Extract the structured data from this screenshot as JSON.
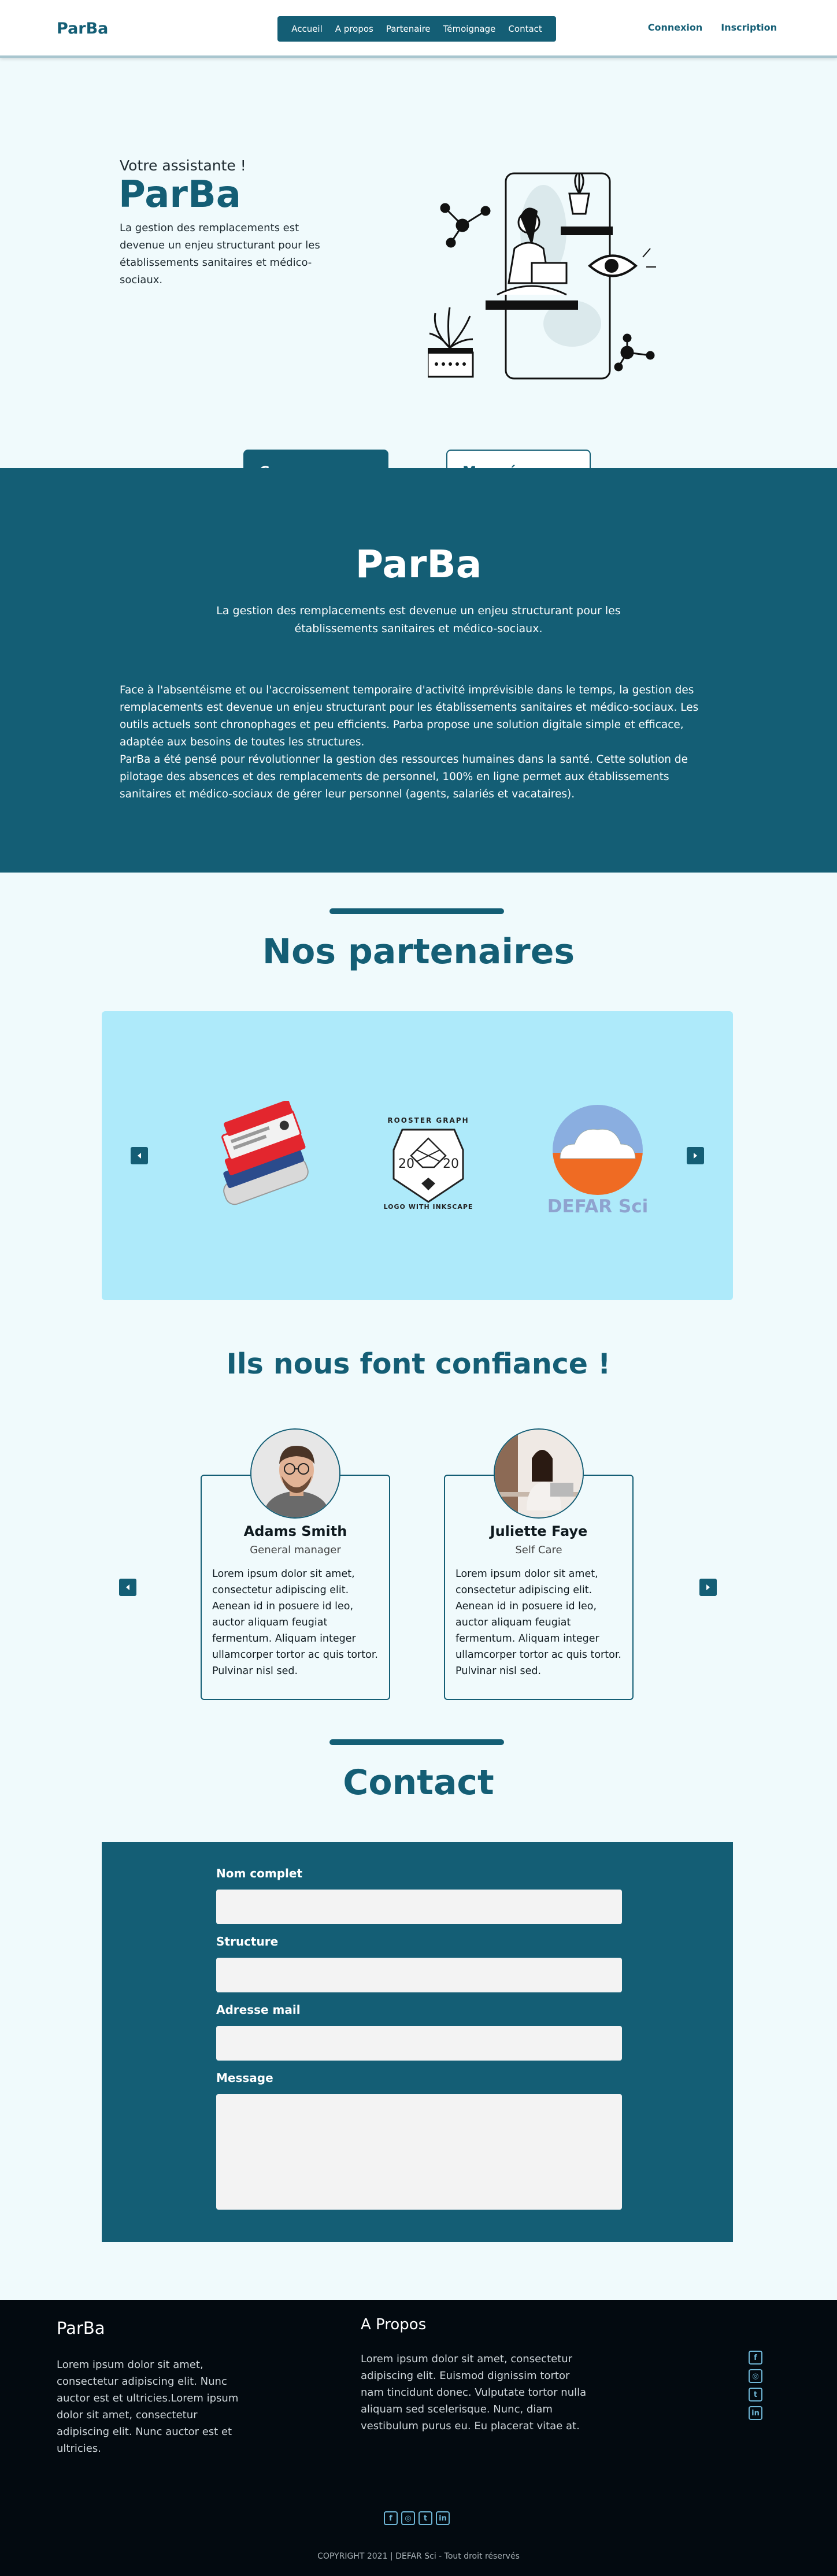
{
  "nav": {
    "logo": "ParBa",
    "menu": [
      "Accueil",
      "A propos",
      "Partenaire",
      "Témoignage",
      "Contact"
    ],
    "login": "Connexion",
    "signup": "Inscription"
  },
  "hero": {
    "kicker": "Votre assistante !",
    "title": "ParBa",
    "description": "La gestion des remplacements est devenue un enjeu structurant pour les établissements sanitaires et médico-sociaux.",
    "btn_primary": "Commencer",
    "btn_secondary": "Mon réseau"
  },
  "about": {
    "title": "ParBa",
    "subtitle": "La gestion des remplacements est devenue un enjeu structurant pour les établissements sanitaires et médico-sociaux.",
    "paragraph1": "Face à l'absentéisme et ou l'accroissement temporaire d'activité imprévisible dans le temps, la gestion des remplacements est devenue un enjeu structurant pour les établissements sanitaires et médico-sociaux. Les outils actuels sont chronophages et peu efficients. Parba propose une solution digitale simple et efficace, adaptée aux besoins de toutes les structures.",
    "paragraph2": "ParBa a été pensé pour révolutionner la gestion des ressources humaines dans la santé. Cette solution de pilotage des absences et des remplacements de personnel, 100% en ligne permet aux établissements sanitaires et médico-sociaux de gérer leur personnel (agents, salariés et vacataires)."
  },
  "partners": {
    "title": "Nos partenaires",
    "logo2_top": "ROOSTER GRAPH",
    "logo2_left": "20",
    "logo2_right": "20",
    "logo2_bottom": "LOGO WITH INKSCAPE",
    "logo3_text": "DEFAR Sci"
  },
  "testimonials": {
    "title": "Ils nous font confiance !",
    "items": [
      {
        "name": "Adams Smith",
        "role": "General manager",
        "text": "Lorem ipsum dolor sit amet, consectetur adipiscing elit. Aenean id in posuere id leo, auctor aliquam feugiat fermentum. Aliquam integer ullamcorper tortor ac quis tortor. Pulvinar nisl sed."
      },
      {
        "name": "Juliette Faye",
        "role": "Self Care",
        "text": "Lorem ipsum dolor sit amet, consectetur adipiscing elit. Aenean id in posuere id leo, auctor aliquam feugiat fermentum. Aliquam integer ullamcorper tortor ac quis tortor. Pulvinar nisl sed."
      }
    ]
  },
  "contact": {
    "title": "Contact",
    "fields": {
      "name": "Nom complet",
      "structure": "Structure",
      "email": "Adresse mail",
      "message": "Message"
    }
  },
  "footer": {
    "brand": "ParBa",
    "brand_text": "Lorem ipsum dolor sit amet, consectetur adipiscing elit. Nunc auctor est et ultricies.Lorem ipsum dolor sit amet, consectetur adipiscing elit. Nunc auctor est et ultricies.",
    "about_title": "A Propos",
    "about_text": "Lorem ipsum dolor sit amet, consectetur adipiscing elit. Euismod dignissim tortor nam tincidunt donec. Vulputate tortor nulla aliquam sed scelerisque. Nunc, diam vestibulum purus eu. Eu placerat vitae at.",
    "copyright": "COPYRIGHT 2021 | DEFAR Sci - Tout droit réservés"
  },
  "colors": {
    "primary": "#145e75",
    "background": "#f0fafc",
    "partners_bg": "#aeeafa",
    "footer_bg": "#030a10"
  },
  "icons": [
    "cloud-upload-icon",
    "chevron-down-icon",
    "arrow-left-icon",
    "arrow-right-icon",
    "facebook-icon",
    "instagram-icon",
    "twitter-icon",
    "linkedin-icon"
  ]
}
